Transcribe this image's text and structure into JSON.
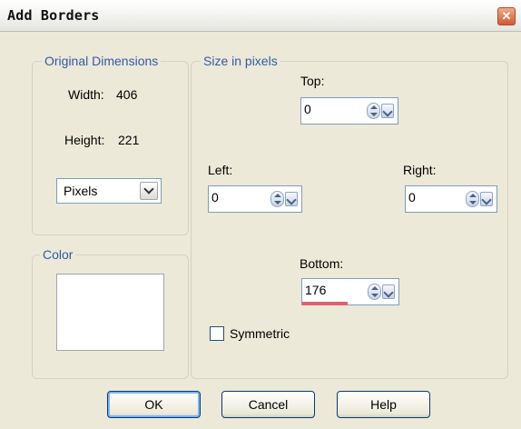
{
  "window": {
    "title": "Add Borders",
    "close_glyph": "✕"
  },
  "original_dimensions": {
    "legend": "Original Dimensions",
    "width_label": "Width:",
    "width_value": "406",
    "height_label": "Height:",
    "height_value": "221",
    "units_selected": "Pixels"
  },
  "color": {
    "legend": "Color",
    "swatch": "#ffffff"
  },
  "size_in_pixels": {
    "legend": "Size in pixels",
    "top": {
      "label": "Top:",
      "value": "0"
    },
    "left": {
      "label": "Left:",
      "value": "0"
    },
    "right": {
      "label": "Right:",
      "value": "0"
    },
    "bottom": {
      "label": "Bottom:",
      "value": "176"
    },
    "symmetric": {
      "label": "Symmetric",
      "checked": false
    }
  },
  "buttons": {
    "ok": "OK",
    "cancel": "Cancel",
    "help": "Help"
  }
}
